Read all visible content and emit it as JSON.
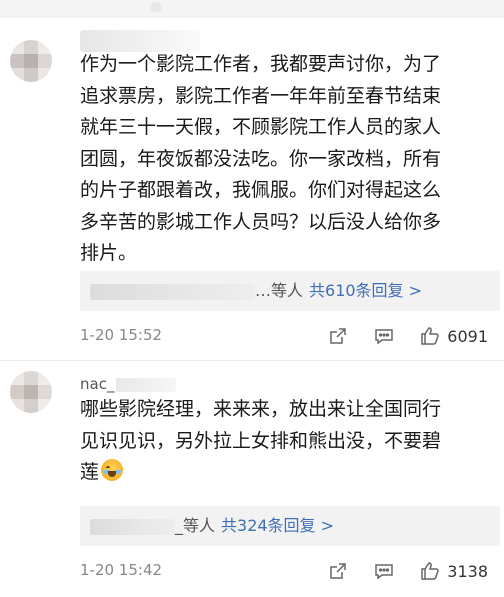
{
  "comments": [
    {
      "text": "作为一个影院工作者，我都要声讨你，为了\n追求票房，影院工作者一年年前至春节结束\n就年三十一天假，不顾影院工作人员的家人\n团圆，年夜饭都没法吃。你一家改档，所有\n的片子都跟着改，我佩服。你们对得起这么\n多辛苦的影城工作人员吗？以后没人给你多\n排片。",
      "reply_summary": {
        "names_suffix": "…等人",
        "count_label": "共610条回复 >"
      },
      "timestamp": "1-20 15:52",
      "likes": "6091",
      "icons": [
        "share-icon",
        "comment-icon",
        "like-icon"
      ]
    },
    {
      "username_visible": "nac_",
      "text": "哪些影院经理，来来来，放出来让全国同行\n见识见识，另外拉上女排和熊出没，不要碧\n莲",
      "emoji": "crying-laughing-emoji",
      "reply_summary": {
        "names_suffix": "_等人",
        "count_label": "共324条回复 >"
      },
      "timestamp": "1-20 15:42",
      "likes": "3138",
      "icons": [
        "share-icon",
        "comment-icon",
        "like-icon"
      ]
    }
  ],
  "colors": {
    "link": "#3f6fb3",
    "meta": "#888888",
    "reply_bg": "#f2f2f2"
  }
}
